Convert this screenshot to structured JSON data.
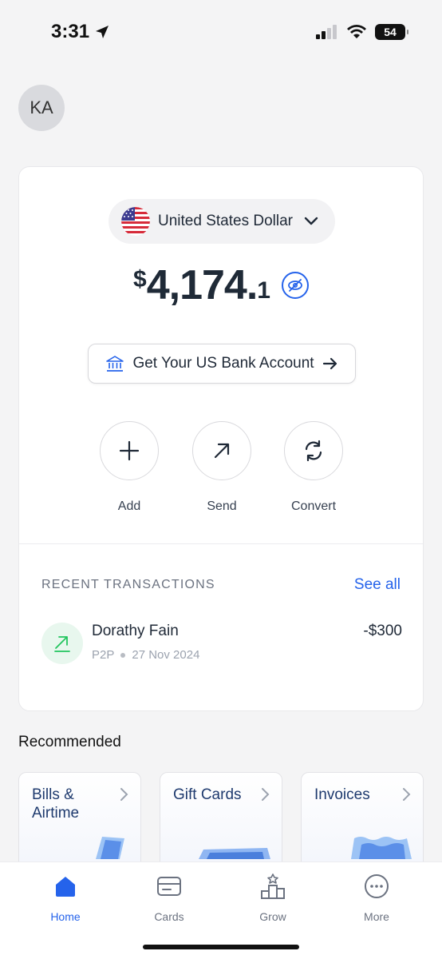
{
  "status_bar": {
    "time": "3:31",
    "battery": "54"
  },
  "profile": {
    "initials": "KA"
  },
  "wallet": {
    "currency_label": "United States Dollar",
    "balance_symbol": "$",
    "balance_main": "4,174.",
    "balance_decimal": "1",
    "bank_button_label": "Get Your US Bank Account"
  },
  "actions": [
    {
      "label": "Add",
      "icon": "plus-icon"
    },
    {
      "label": "Send",
      "icon": "arrow-up-right-icon"
    },
    {
      "label": "Convert",
      "icon": "refresh-icon"
    }
  ],
  "recent": {
    "title": "RECENT TRANSACTIONS",
    "see_all": "See all",
    "transactions": [
      {
        "name": "Dorathy Fain",
        "type": "P2P",
        "date": "27 Nov 2024",
        "amount": "-$300"
      }
    ]
  },
  "recommended": {
    "title": "Recommended",
    "cards": [
      {
        "label": "Bills & Airtime"
      },
      {
        "label": "Gift Cards"
      },
      {
        "label": "Invoices"
      }
    ]
  },
  "nav": [
    {
      "label": "Home",
      "icon": "home-icon",
      "active": true
    },
    {
      "label": "Cards",
      "icon": "card-icon",
      "active": false
    },
    {
      "label": "Grow",
      "icon": "podium-icon",
      "active": false
    },
    {
      "label": "More",
      "icon": "more-icon",
      "active": false
    }
  ],
  "colors": {
    "accent": "#2563eb",
    "background": "#f4f4f5",
    "positive_bg": "#e8f7ee",
    "positive": "#22c55e"
  }
}
